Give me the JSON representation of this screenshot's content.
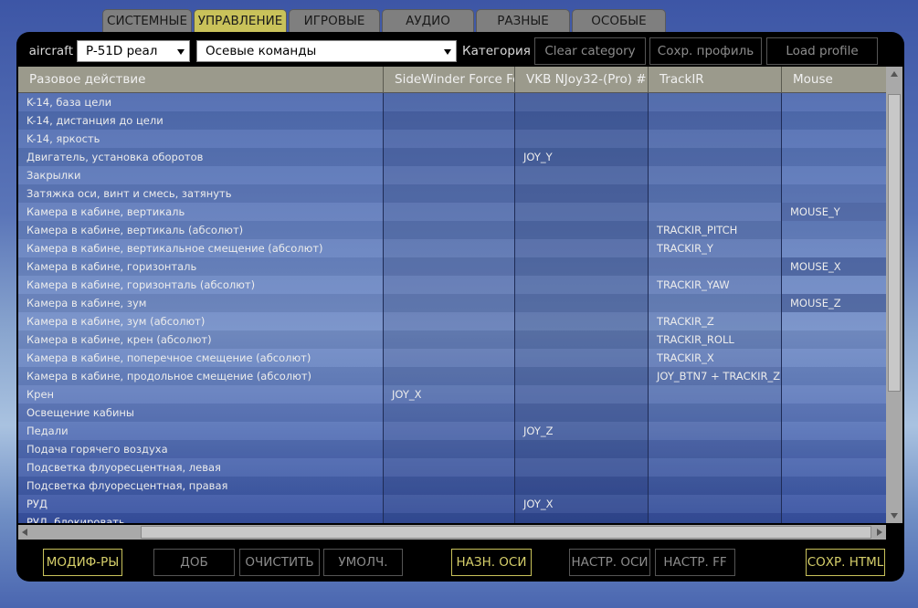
{
  "tabs": [
    "СИСТЕМНЫЕ",
    "УПРАВЛЕНИЕ",
    "ИГРОВЫЕ",
    "АУДИО",
    "РАЗНЫЕ",
    "ОСОБЫЕ"
  ],
  "active_tab": "УПРАВЛЕНИЕ",
  "toolbar": {
    "aircraft_label": "aircraft",
    "aircraft_value": "P-51D реал",
    "mode_value": "Осевые команды",
    "category_label": "Категория",
    "clear_category": "Clear category",
    "save_profile": "Сохр. профиль",
    "load_profile": "Load profile"
  },
  "table": {
    "headers": [
      "Разовое действие",
      "SideWinder Force Fe",
      "VKB NJoy32-(Pro)  #",
      "TrackIR",
      "Mouse"
    ],
    "rows": [
      [
        "K-14, база цели",
        "",
        "",
        "",
        ""
      ],
      [
        "K-14, дистанция до цели",
        "",
        "",
        "",
        ""
      ],
      [
        "K-14, яркость",
        "",
        "",
        "",
        ""
      ],
      [
        "Двигатель, установка оборотов",
        "",
        "JOY_Y",
        "",
        ""
      ],
      [
        "Закрылки",
        "",
        "",
        "",
        ""
      ],
      [
        "Затяжка оси, винт и смесь, затянуть",
        "",
        "",
        "",
        ""
      ],
      [
        "Камера в кабине, вертикаль",
        "",
        "",
        "",
        "MOUSE_Y"
      ],
      [
        "Камера в кабине, вертикаль (абсолют)",
        "",
        "",
        "TRACKIR_PITCH",
        ""
      ],
      [
        "Камера в кабине, вертикальное смещение (абсолют)",
        "",
        "",
        "TRACKIR_Y",
        ""
      ],
      [
        "Камера в кабине, горизонталь",
        "",
        "",
        "",
        "MOUSE_X"
      ],
      [
        "Камера в кабине, горизонталь (абсолют)",
        "",
        "",
        "TRACKIR_YAW",
        ""
      ],
      [
        "Камера в кабине, зум",
        "",
        "",
        "",
        "MOUSE_Z"
      ],
      [
        "Камера в кабине, зум (абсолют)",
        "",
        "",
        "TRACKIR_Z",
        ""
      ],
      [
        "Камера в кабине, крен (абсолют)",
        "",
        "",
        "TRACKIR_ROLL",
        ""
      ],
      [
        "Камера в кабине, поперечное смещение (абсолют)",
        "",
        "",
        "TRACKIR_X",
        ""
      ],
      [
        "Камера в кабине, продольное смещение (абсолют)",
        "",
        "",
        "JOY_BTN7 + TRACKIR_Z",
        ""
      ],
      [
        "Крен",
        "JOY_X",
        "",
        "",
        ""
      ],
      [
        "Освещение кабины",
        "",
        "",
        "",
        ""
      ],
      [
        "Педали",
        "",
        "JOY_Z",
        "",
        ""
      ],
      [
        "Подача горячего воздуха",
        "",
        "",
        "",
        ""
      ],
      [
        "Подсветка флуоресцентная, левая",
        "",
        "",
        "",
        ""
      ],
      [
        "Подсветка флуоресцентная, правая",
        "",
        "",
        "",
        ""
      ],
      [
        "РУД",
        "",
        "JOY_X",
        "",
        ""
      ],
      [
        "РУД, блокировать",
        "",
        "",
        "",
        ""
      ]
    ]
  },
  "bottom_buttons": [
    {
      "label": "МОДИФ-РЫ",
      "active": true
    },
    {
      "label": "ДОБ",
      "active": false
    },
    {
      "label": "ОЧИСТИТЬ",
      "active": false
    },
    {
      "label": "УМОЛЧ.",
      "active": false
    },
    {
      "label": "НАЗН. ОСИ",
      "active": true
    },
    {
      "label": "НАСТР. ОСИ",
      "active": false
    },
    {
      "label": "НАСТР. FF",
      "active": false
    },
    {
      "label": "СОХР. HTML",
      "active": true
    }
  ]
}
